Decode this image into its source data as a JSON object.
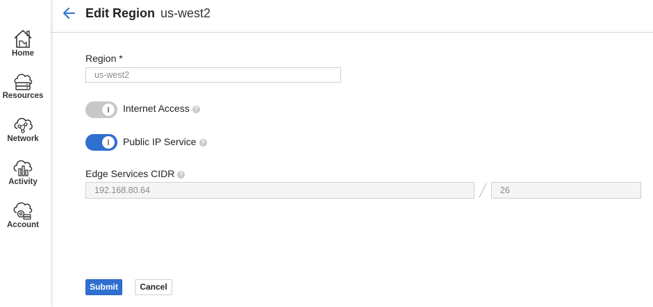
{
  "sidebar": {
    "items": [
      {
        "label": "Home",
        "icon": "home-icon"
      },
      {
        "label": "Resources",
        "icon": "cloud-server-icon"
      },
      {
        "label": "Network",
        "icon": "cloud-network-icon"
      },
      {
        "label": "Activity",
        "icon": "cloud-chart-icon"
      },
      {
        "label": "Account",
        "icon": "cloud-gear-icon"
      }
    ]
  },
  "header": {
    "title": "Edit Region",
    "subtitle": "us-west2"
  },
  "form": {
    "region_label": "Region *",
    "region_placeholder": "us-west2",
    "internet_access_label": "Internet Access",
    "internet_access_enabled": false,
    "public_ip_label": "Public IP Service",
    "public_ip_enabled": true,
    "cidr_label": "Edge Services CIDR",
    "cidr_ip_placeholder": "192.168.80.64",
    "cidr_prefix_placeholder": "26",
    "help_glyph": "?"
  },
  "actions": {
    "submit_label": "Submit",
    "cancel_label": "Cancel"
  },
  "colors": {
    "accent": "#2f6fd0",
    "toggle_off": "#c8c8c8"
  }
}
